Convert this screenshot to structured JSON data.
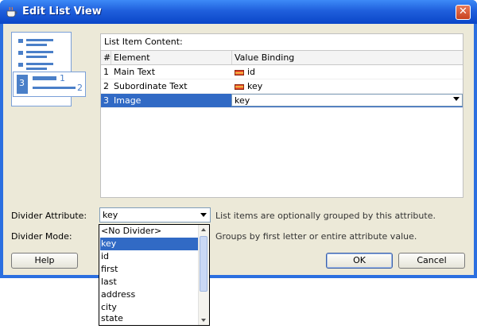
{
  "window": {
    "title": "Edit List View",
    "close_glyph": "✕"
  },
  "content_panel": {
    "title": "List Item Content:",
    "columns": [
      "#",
      "Element",
      "Value Binding"
    ],
    "rows": [
      {
        "num": "1",
        "element": "Main Text",
        "binding": "id"
      },
      {
        "num": "2",
        "element": "Subordinate Text",
        "binding": "key"
      },
      {
        "num": "3",
        "element": "Image",
        "binding": "key"
      }
    ]
  },
  "preview": {
    "num1": "1",
    "num2": "2",
    "num3": "3"
  },
  "divider_attribute": {
    "label": "Divider Attribute:",
    "value": "key",
    "hint": "List items are optionally grouped by this attribute.",
    "options": [
      "<No Divider>",
      "key",
      "id",
      "first",
      "last",
      "address",
      "city",
      "state"
    ],
    "selected_index": 1
  },
  "divider_mode": {
    "label": "Divider Mode:",
    "hint": "Groups by first letter or entire attribute value."
  },
  "buttons": {
    "help": "Help",
    "ok": "OK",
    "cancel": "Cancel"
  },
  "colors": {
    "selection": "#316ac5",
    "titlebar": "#1f5fdc",
    "client": "#ece9d8"
  }
}
